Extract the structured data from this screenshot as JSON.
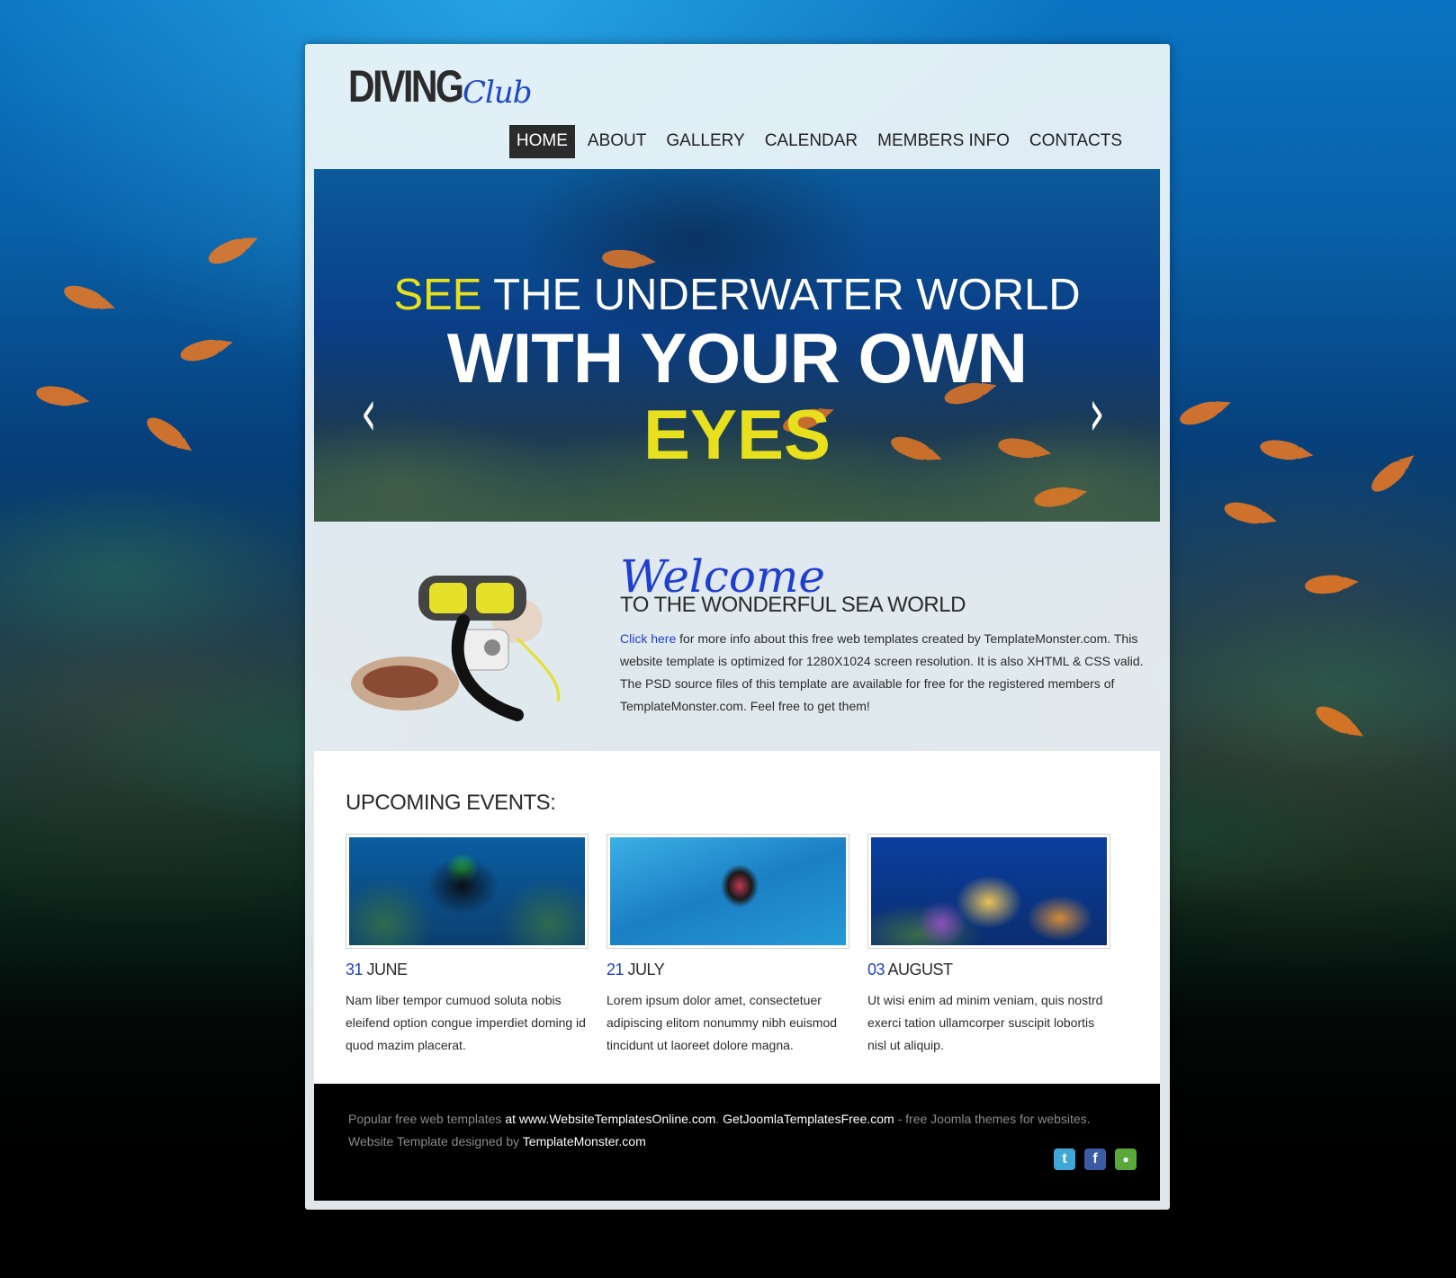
{
  "logo": {
    "main": "DIVING",
    "script": "Club"
  },
  "nav": [
    {
      "label": "HOME",
      "active": true
    },
    {
      "label": "ABOUT"
    },
    {
      "label": "GALLERY"
    },
    {
      "label": "CALENDAR"
    },
    {
      "label": "MEMBERS INFO"
    },
    {
      "label": "CONTACTS"
    }
  ],
  "hero": {
    "line1_highlight": "SEE",
    "line1_rest": " THE UNDERWATER WORLD",
    "line2": "WITH YOUR OWN",
    "line3": "EYES",
    "prev_icon": "‹",
    "next_icon": "›"
  },
  "welcome": {
    "script": "Welcome",
    "subtitle": "TO THE WONDERFUL SEA WORLD",
    "link": "Click here",
    "text": " for more info about this free web templates created by TemplateMonster.com. This website template is optimized for 1280X1024 screen resolution. It is also XHTML & CSS valid. The PSD source files of this template are available for free for the registered members of TemplateMonster.com. Feel free to get them!"
  },
  "events": {
    "title": "UPCOMING EVENTS:",
    "items": [
      {
        "day": "31",
        "month": " JUNE",
        "text": "Nam liber tempor cumuod soluta nobis eleifend option congue imperdiet doming id quod mazim placerat."
      },
      {
        "day": "21",
        "month": " JULY",
        "text": "Lorem ipsum dolor amet, consectetuer adipiscing elitom nonummy nibh euismod tincidunt ut laoreet dolore magna."
      },
      {
        "day": "03",
        "month": " AUGUST",
        "text": "Ut wisi enim ad minim veniam, quis nostrd exerci tation ullamcorper suscipit lobortis nisl ut aliquip."
      }
    ]
  },
  "footer": {
    "t1": "Popular free web templates",
    "t2": " at www.WebsiteTemplatesOnline.com",
    "t3": ". ",
    "t4": "GetJoomlaTemplatesFree.com",
    "t5": " - free Joomla themes for websites.",
    "t6": "Website Template designed by ",
    "t7": "TemplateMonster.com"
  },
  "social": [
    {
      "name": "twitter-icon",
      "glyph": "t",
      "color": "#3fa7d8"
    },
    {
      "name": "facebook-icon",
      "glyph": "f",
      "color": "#3b5ba4"
    },
    {
      "name": "feed-icon",
      "glyph": "●",
      "color": "#5aa83a"
    }
  ],
  "colors": {
    "accent": "#1f3fd0",
    "highlight": "#e8df1d",
    "dark": "#2b2b2b"
  }
}
